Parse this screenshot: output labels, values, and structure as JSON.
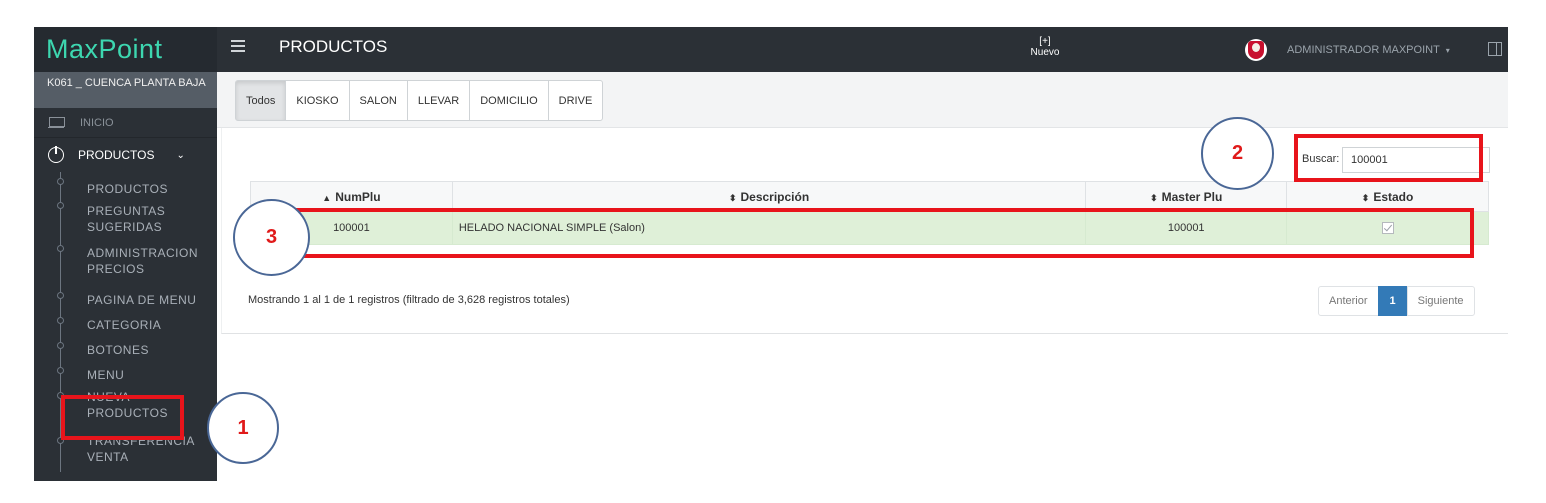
{
  "sidebar": {
    "brand": "MaxPoint",
    "store": "K061 _ CUENCA PLANTA BAJA",
    "inicio": "INICIO",
    "group": "PRODUCTOS",
    "items": [
      {
        "label": "PRODUCTOS"
      },
      {
        "label": "PREGUNTAS SUGERIDAS"
      },
      {
        "label": "ADMINISTRACION PRECIOS"
      },
      {
        "label": "PAGINA DE MENU"
      },
      {
        "label": "CATEGORIA"
      },
      {
        "label": "BOTONES"
      },
      {
        "label": "MENU"
      },
      {
        "label": "NUEVA PRODUCTOS"
      },
      {
        "label": "TRANSFERENCIA VENTA"
      }
    ]
  },
  "topbar": {
    "title": "PRODUCTOS",
    "new_label": "Nuevo",
    "new_glyph": "[+]",
    "user": "ADMINISTRADOR MAXPOINT",
    "user_caret": "▾"
  },
  "tabs": [
    "Todos",
    "KIOSKO",
    "SALON",
    "LLEVAR",
    "DOMICILIO",
    "DRIVE"
  ],
  "search": {
    "label": "Buscar:",
    "value": "100001"
  },
  "table": {
    "headers": [
      "NumPlu",
      "Descripción",
      "Master Plu",
      "Estado"
    ],
    "header_glyphs": [
      "▲",
      "⬍",
      "⬍",
      "⬍"
    ],
    "rows": [
      {
        "numplu": "100001",
        "descripcion": "HELADO NACIONAL SIMPLE (Salon)",
        "masterplu": "100001",
        "estado": true
      }
    ]
  },
  "info": "Mostrando 1 al 1 de 1 registros (filtrado de 3,628 registros totales)",
  "pagination": {
    "prev": "Anterior",
    "current": "1",
    "next": "Siguiente"
  },
  "annotations": [
    "1",
    "2",
    "3"
  ],
  "colors": {
    "brand": "#3dd7b0",
    "annotation_red": "#e8141b",
    "annotation_ring": "#4a6796",
    "row_highlight": "#dff0d8",
    "pager_active": "#337ab7"
  }
}
